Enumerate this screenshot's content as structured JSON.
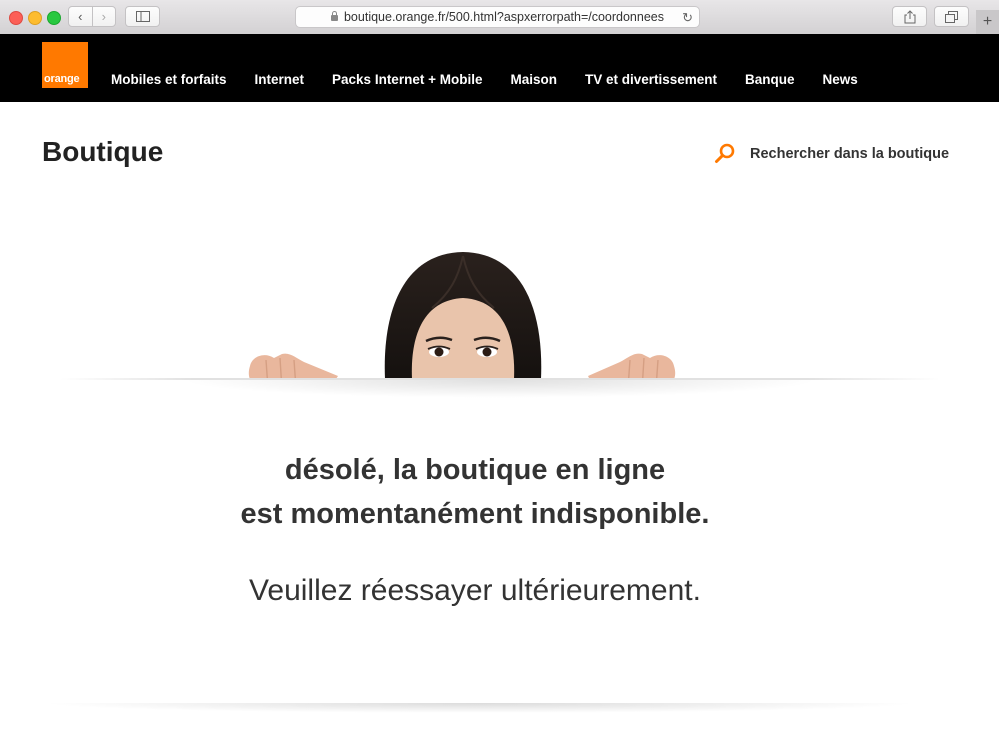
{
  "browser": {
    "url": "boutique.orange.fr/500.html?aspxerrorpath=/coordonnees",
    "back_icon": "chevron-left-icon",
    "forward_icon": "chevron-right-icon",
    "add_tab": "+"
  },
  "header": {
    "logo_text": "orange",
    "nav": [
      "Mobiles et forfaits",
      "Internet",
      "Packs Internet + Mobile",
      "Maison",
      "TV et divertissement",
      "Banque",
      "News"
    ]
  },
  "page": {
    "title": "Boutique",
    "search_label": "Rechercher dans la boutique",
    "error_line1": "désolé, la boutique en ligne",
    "error_line2": "est momentanément indisponible.",
    "retry": "Veuillez réessayer ultérieurement."
  },
  "colors": {
    "brand": "#ff7900",
    "nav_bg": "#000000",
    "text": "#333333"
  }
}
